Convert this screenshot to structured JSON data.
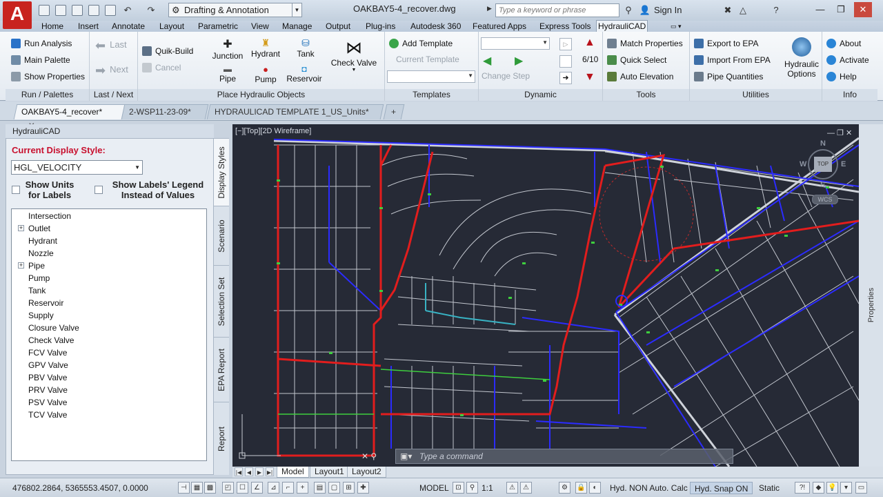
{
  "title_bar": {
    "logo_letter": "A",
    "workspace": "Drafting & Annotation",
    "file_title": "OAKBAY5-4_recover.dwg",
    "search_placeholder": "Type a keyword or phrase",
    "sign_in": "Sign In"
  },
  "ribbon_tabs": [
    "Home",
    "Insert",
    "Annotate",
    "Layout",
    "Parametric",
    "View",
    "Manage",
    "Output",
    "Plug-ins",
    "Autodesk 360",
    "Featured Apps",
    "Express Tools",
    "HydrauliCAD"
  ],
  "ribbon_active_tab": "HydrauliCAD",
  "ribbon": {
    "run_palettes": {
      "title": "Run / Palettes",
      "run_analysis": "Run Analysis",
      "main_palette": "Main Palette",
      "show_properties": "Show Properties"
    },
    "last_next": {
      "title": "Last / Next",
      "last": "Last",
      "next": "Next"
    },
    "place_objects": {
      "title": "Place Hydraulic Objects",
      "quik_build": "Quik-Build",
      "cancel": "Cancel",
      "junction": "Junction",
      "hydrant": "Hydrant",
      "tank": "Tank",
      "pipe": "Pipe",
      "pump": "Pump",
      "reservoir": "Reservoir",
      "check_valve": "Check Valve"
    },
    "templates": {
      "title": "Templates",
      "add_template": "Add Template",
      "current_template": "Current Template"
    },
    "dynamic": {
      "title": "Dynamic",
      "change_step": "Change Step",
      "step_counter": "6/10"
    },
    "tools": {
      "title": "Tools",
      "match_properties": "Match Properties",
      "quick_select": "Quick Select",
      "auto_elevation": "Auto Elevation"
    },
    "utilities": {
      "title": "Utilities",
      "export_epa": "Export to EPA",
      "import_epa": "Import From EPA",
      "pipe_quantities": "Pipe Quantities",
      "hydraulic_options": "Hydraulic Options"
    },
    "info": {
      "title": "Info",
      "about": "About",
      "activate": "Activate",
      "help": "Help"
    }
  },
  "doc_tabs": [
    "OAKBAY5-4_recover*",
    "2-WSP11-23-09*",
    "HYDRAULICAD TEMPLATE 1_US_Units*"
  ],
  "palette": {
    "header": "HydrauliCAD",
    "display_style_label": "Current Display Style:",
    "display_style_value": "HGL_VELOCITY",
    "show_units_label": "Show Units for Labels",
    "show_legend_label": "Show Labels' Legend Instead of Values",
    "tree": [
      "Intersection",
      "Outlet",
      "Hydrant",
      "Nozzle",
      "Pipe",
      "Pump",
      "Tank",
      "Reservoir",
      "Supply",
      "Closure Valve",
      "Check Valve",
      "FCV Valve",
      "GPV Valve",
      "PBV Valve",
      "PRV Valve",
      "PSV Valve",
      "TCV Valve"
    ],
    "tree_expandable": [
      "Outlet",
      "Pipe"
    ],
    "side_tabs": [
      "Display Styles",
      "Scenario",
      "Selection Set",
      "EPA Report",
      "Report"
    ]
  },
  "canvas": {
    "view_label": "[−][Top][2D Wireframe]",
    "command_placeholder": "Type a command",
    "viewcube": {
      "top": "TOP",
      "north": "N",
      "south": "S",
      "east": "E",
      "west": "W",
      "wcs": "WCS"
    },
    "right_panel": "Properties",
    "colors": {
      "background": "#262a36",
      "parcel": "#dfe3ea",
      "main": "#e21d1d",
      "branch": "#2b2bff",
      "node": "#3ecf3e"
    }
  },
  "layout_tabs": [
    "Model",
    "Layout1",
    "Layout2"
  ],
  "status_bar": {
    "coordinates": "476802.2864, 5365553.4507, 0.0000",
    "model": "MODEL",
    "scale": "1:1",
    "hyd_calc": "Hyd. NON Auto. Calc",
    "hyd_snap": "Hyd. Snap ON",
    "static": "Static"
  }
}
